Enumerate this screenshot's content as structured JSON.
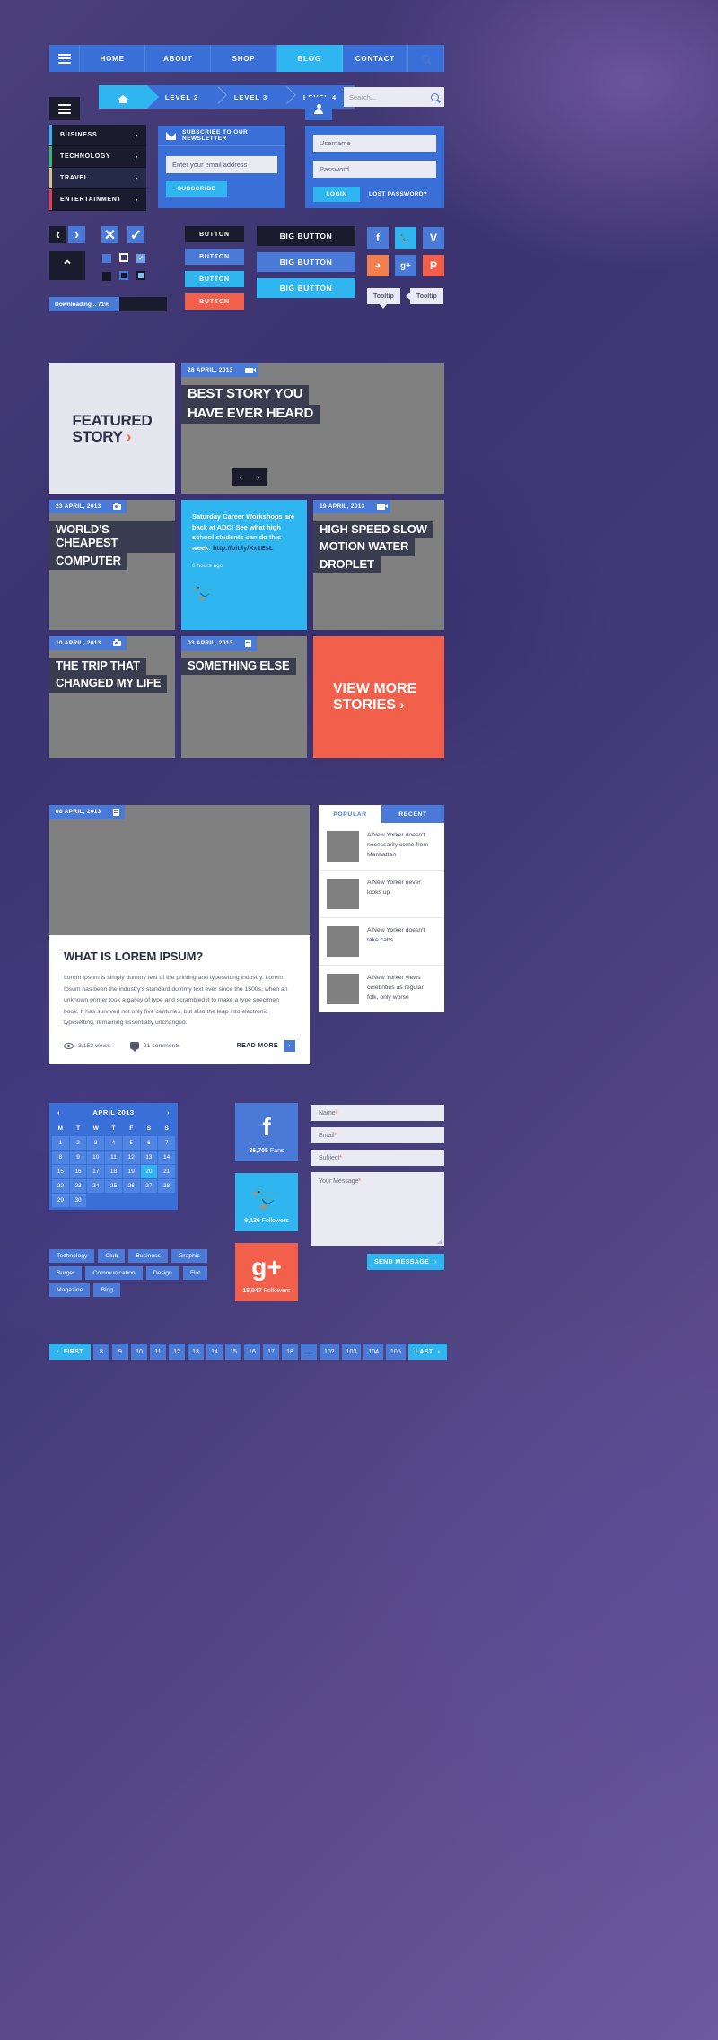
{
  "topnav": {
    "items": [
      "HOME",
      "ABOUT",
      "SHOP",
      "BLOG",
      "CONTACT"
    ],
    "active": "BLOG",
    "burger_icon": "hamburger-icon",
    "search_icon": "search-icon"
  },
  "breadcrumb": {
    "home_icon": "home-icon",
    "levels": [
      "LEVEL 2",
      "LEVEL 3",
      "LEVEL 4"
    ]
  },
  "search": {
    "placeholder": "Search...",
    "icon": "magnifier-icon"
  },
  "sidemenu": {
    "burger_icon": "hamburger-icon",
    "items": [
      {
        "label": "BUSINESS",
        "color": "#2fb5ef",
        "hover": false
      },
      {
        "label": "TECHNOLOGY",
        "color": "#2eb872",
        "hover": false
      },
      {
        "label": "TRAVEL",
        "color": "#d8c47a",
        "hover": true
      },
      {
        "label": "ENTERTAINMENT",
        "color": "#e0404a",
        "hover": false
      }
    ],
    "arrow": "›"
  },
  "newsletter": {
    "icon": "envelope-icon",
    "title": "SUBSCRIBE TO OUR NEWSLETTER",
    "email_placeholder": "Enter your email address",
    "button": "SUBSCRIBE"
  },
  "login": {
    "user_icon": "user-icon",
    "username_placeholder": "Username",
    "password_placeholder": "Password",
    "button": "LOGIN",
    "lost_password": "LOST PASSWORD?"
  },
  "controls": {
    "prev": "‹",
    "next": "›",
    "close": "✕",
    "check": "✓",
    "up": "⌃",
    "progress_label": "Downloading... 71%",
    "progress_percent": 71
  },
  "buttons": {
    "small": [
      "BUTTON",
      "BUTTON",
      "BUTTON",
      "BUTTON"
    ],
    "big": [
      "BIG BUTTON",
      "BIG BUTTON",
      "BIG BUTTON"
    ]
  },
  "social_icons": [
    {
      "name": "facebook-icon",
      "glyph": "f",
      "color": "#4a7ad8"
    },
    {
      "name": "twitter-icon",
      "glyph": "ᵗ",
      "color": "#2fb5ef"
    },
    {
      "name": "vimeo-icon",
      "glyph": "V",
      "color": "#4a7ad8"
    },
    {
      "name": "rss-icon",
      "glyph": "●",
      "color": "#f2804c"
    },
    {
      "name": "googleplus-icon",
      "glyph": "g+",
      "color": "#4a7ad8"
    },
    {
      "name": "pinterest-icon",
      "glyph": "P",
      "color": "#f2604c"
    }
  ],
  "tooltips": {
    "down": "Tooltip",
    "left": "Tooltip"
  },
  "grid": {
    "featured": {
      "line1": "FEATURED",
      "line2": "STORY",
      "arrow": "›"
    },
    "cards": [
      {
        "date": "28 APRIL, 2013",
        "icon": "video-icon",
        "title_1": "BEST STORY YOU",
        "title_2": "HAVE EVER HEARD"
      },
      {
        "date": "23 APRIL, 2013",
        "icon": "camera-icon",
        "title_1": "WORLD'S CHEAPEST",
        "title_2": "COMPUTER"
      },
      {
        "date": "19 APRIL, 2013",
        "icon": "video-icon",
        "title_1": "HIGH SPEED SLOW",
        "title_2": "MOTION WATER",
        "title_3": "DROPLET"
      },
      {
        "date": "10 APRIL, 2013",
        "icon": "camera-icon",
        "title_1": "THE TRIP THAT",
        "title_2": "CHANGED MY LIFE"
      },
      {
        "date": "03 APRIL, 2013",
        "icon": "doc-icon",
        "title_1": "SOMETHING ELSE"
      }
    ],
    "tweet": {
      "text": "Saturday Career Workshops are back at ADC! See what high school students can do this week:",
      "link": "http://bit.ly/Xx1EsL",
      "time": "6 hours ago",
      "bird_icon": "twitter-bird-icon"
    },
    "viewmore": {
      "line1": "VIEW MORE",
      "line2": "STORIES",
      "arrow": "›"
    },
    "slider_prev": "‹",
    "slider_next": "›"
  },
  "article": {
    "date": "08 APRIL, 2013",
    "icon": "doc-icon",
    "title": "WHAT IS LOREM IPSUM?",
    "body": "Lorem Ipsum is simply dummy text of the printing and typesetting industry. Lorem Ipsum has been the industry's standard dummy text ever since the 1500s, when an unknown printer took a galley of type and scrambled it to make a type specimen book. It has survived not only five centuries, but also the leap into electronic typesetting, remaining essentially unchanged.",
    "views": "3,152 views",
    "comments": "21 comments",
    "readmore": "READ MORE",
    "readmore_arrow": "›",
    "views_icon": "eye-icon",
    "comments_icon": "comment-bubble-icon"
  },
  "widget": {
    "tabs": [
      {
        "label": "POPULAR",
        "active": true
      },
      {
        "label": "RECENT",
        "active": false
      }
    ],
    "items": [
      "A New Yorker doesn't necessarily come from Manhattan",
      "A New Yorker never looks up",
      "A New Yorker doesn't take cabs",
      "A New Yorker views celebrities as regular folk, only worse"
    ]
  },
  "calendar": {
    "title": "APRIL 2013",
    "prev": "‹",
    "next": "›",
    "dow": [
      "M",
      "T",
      "W",
      "T",
      "F",
      "S",
      "S"
    ],
    "weeks": [
      [
        "1",
        "2",
        "3",
        "4",
        "5",
        "6",
        "7"
      ],
      [
        "8",
        "9",
        "10",
        "11",
        "12",
        "13",
        "14"
      ],
      [
        "15",
        "16",
        "17",
        "18",
        "19",
        "20",
        "21"
      ],
      [
        "22",
        "23",
        "24",
        "25",
        "26",
        "27",
        "28"
      ],
      [
        "29",
        "30",
        "",
        "",
        "",
        "",
        ""
      ]
    ],
    "selected": [
      "20"
    ]
  },
  "tags": [
    "Technology",
    "Club",
    "Business",
    "Graphic",
    "Burger",
    "Communication",
    "Design",
    "Flat",
    "Magazine",
    "Blog"
  ],
  "social_counters": [
    {
      "name": "facebook-counter",
      "glyph": "f",
      "count": "36,705",
      "label": "Fans",
      "color": "#4a7ad8"
    },
    {
      "name": "twitter-counter",
      "glyph": "ᵗ",
      "count": "9,136",
      "label": "Followers",
      "color": "#2fb5ef"
    },
    {
      "name": "googleplus-counter",
      "glyph": "g+",
      "count": "15,047",
      "label": "Followers",
      "color": "#f2604c"
    }
  ],
  "form": {
    "name": "Name",
    "email": "Email",
    "subject": "Subject",
    "message": "Your Message",
    "required_mark": "*",
    "send": "SEND MESSAGE",
    "send_arrow": "›"
  },
  "pagination": {
    "first": "FIRST",
    "first_arrow": "‹",
    "last": "LAST",
    "last_arrow": "›",
    "pages": [
      "8",
      "9",
      "10",
      "11",
      "12",
      "13",
      "14",
      "15",
      "16",
      "17",
      "18",
      "...",
      "102",
      "103",
      "104",
      "105"
    ]
  },
  "colors": {
    "blue": "#4a7ad8",
    "cyan": "#2fb5ef",
    "red": "#f2604c",
    "dark": "#1a1c2e",
    "gray": "#808080",
    "light": "#e9eaf2"
  }
}
